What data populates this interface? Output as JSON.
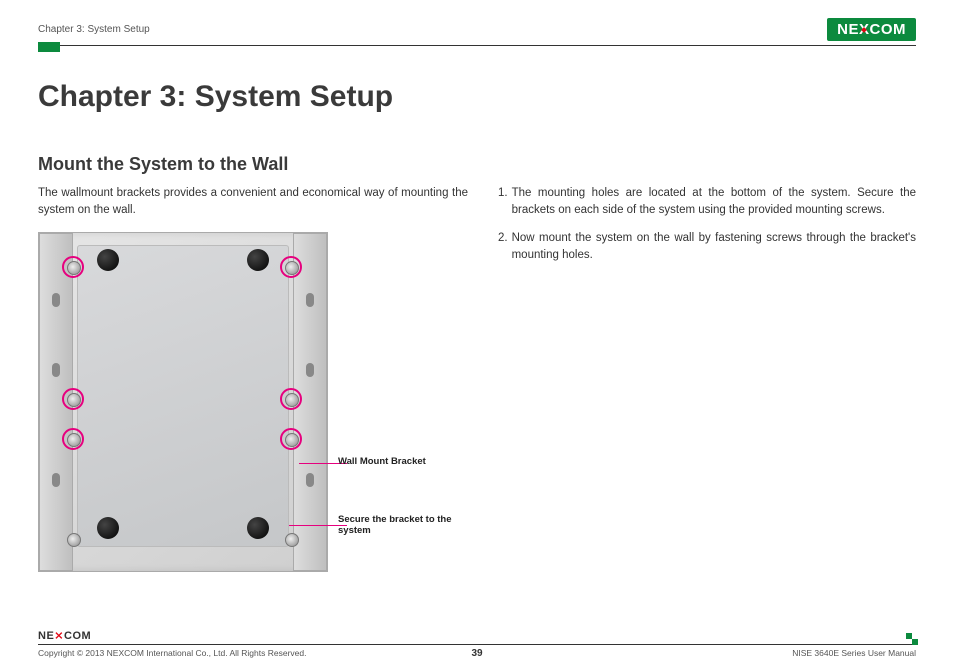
{
  "header": {
    "breadcrumb": "Chapter 3: System Setup",
    "brand": "NEXCOM"
  },
  "title": "Chapter 3: System Setup",
  "section": {
    "heading": "Mount the System to the Wall",
    "intro": "The wallmount brackets provides a convenient and economical way of mounting the system on the wall."
  },
  "callouts": {
    "bracket": "Wall Mount Bracket",
    "secure": "Secure the bracket to the system"
  },
  "steps": [
    {
      "num": "1.",
      "text": "The mounting holes are located at the bottom of the system. Secure the brackets on each side of the system using the provided mounting screws."
    },
    {
      "num": "2.",
      "text": "Now mount the system on the wall by fastening screws through the bracket's mounting holes."
    }
  ],
  "footer": {
    "brand": "NE COM",
    "copyright": "Copyright © 2013 NEXCOM International Co., Ltd. All Rights Reserved.",
    "page": "39",
    "manual": "NISE 3640E Series User Manual"
  }
}
